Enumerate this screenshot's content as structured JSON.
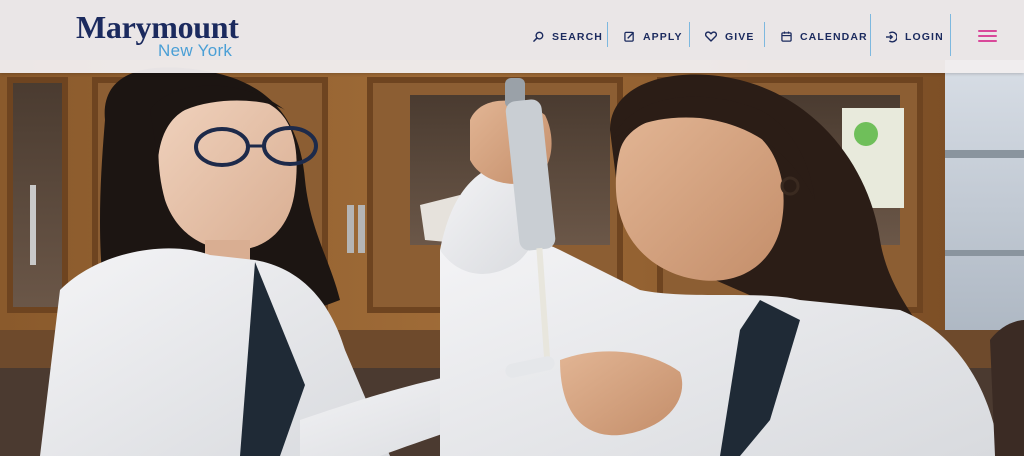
{
  "brand": {
    "name": "Marymount",
    "location": "New York",
    "name_color": "#1b2a5e",
    "location_color": "#4a9fd6"
  },
  "nav": {
    "items": [
      {
        "label": "SEARCH",
        "icon": "search-icon"
      },
      {
        "label": "APPLY",
        "icon": "edit-icon"
      },
      {
        "label": "GIVE",
        "icon": "heart-icon"
      },
      {
        "label": "CALENDAR",
        "icon": "calendar-icon"
      },
      {
        "label": "LOGIN",
        "icon": "login-icon"
      }
    ],
    "text_color": "#1b2a5e",
    "divider_color": "#7db8df",
    "menu_icon": "hamburger-menu-icon",
    "menu_color": "#d9489a"
  }
}
